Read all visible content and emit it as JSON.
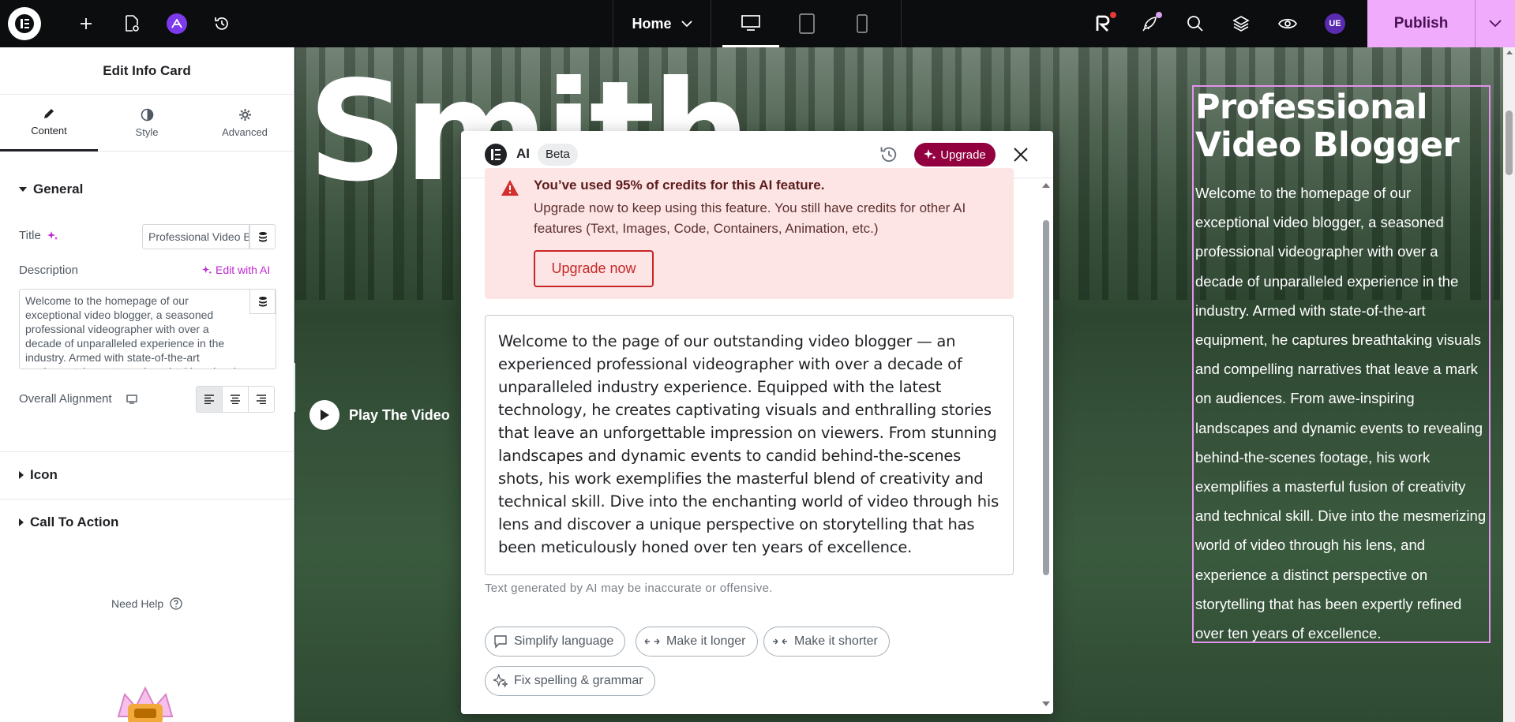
{
  "topbar": {
    "page_selector": "Home",
    "user_initials": "UE",
    "publish_label": "Publish"
  },
  "panel": {
    "title": "Edit Info Card",
    "tabs": [
      {
        "label": "Content",
        "icon": "pencil-icon",
        "active": true
      },
      {
        "label": "Style",
        "icon": "half-circle-icon",
        "active": false
      },
      {
        "label": "Advanced",
        "icon": "gear-icon",
        "active": false
      }
    ],
    "general": {
      "heading": "General",
      "title_label": "Title",
      "title_value": "Professional Video Blogger",
      "description_label": "Description",
      "edit_with_ai": "Edit with AI",
      "description_value": "Welcome to the homepage of our exceptional video blogger, a seasoned professional videographer with over a decade of unparalleled experience in the industry. Armed with state-of-the-art equipment, he captures breathtaking visuals",
      "alignment_label": "Overall Alignment"
    },
    "sections": [
      "Icon",
      "Call To Action"
    ],
    "need_help": "Need Help"
  },
  "canvas": {
    "hero_word": "Smith",
    "play_label": "Play The Video",
    "card_title": "Professional Video Blogger",
    "card_description": "Welcome to the homepage of our exceptional video blogger, a seasoned professional videographer with over a decade of unparalleled experience in the industry. Armed with state-of-the-art equipment, he captures breathtaking visuals and compelling narratives that leave a mark on audiences. From awe-inspiring landscapes and dynamic events to revealing behind-the-scenes footage, his work exemplifies a masterful fusion of creativity and technical skill. Dive into the mesmerizing world of video through his lens, and experience a distinct perspective on storytelling that has been expertly refined over ten years of excellence."
  },
  "ai_modal": {
    "title": "AI",
    "beta": "Beta",
    "upgrade_label": "Upgrade",
    "alert_title": "You’ve used 95% of credits for this AI feature.",
    "alert_text": "Upgrade now to keep using this feature. You still have credits for other AI features (Text, Images, Code, Containers, Animation, etc.)",
    "alert_button": "Upgrade now",
    "result_text": "Welcome to the page of our outstanding video blogger — an experienced professional videographer with over a decade of unparalleled industry experience. Equipped with the latest technology, he creates captivating visuals and enthralling stories that leave an unforgettable impression on viewers. From stunning landscapes and dynamic events to candid behind-the-scenes shots, his work exemplifies the masterful blend of creativity and technical skill. Dive into the enchanting world of video through his lens and discover a unique perspective on storytelling that has been meticulously honed over ten years of excellence.",
    "disclaimer": "Text generated by AI may be inaccurate or offensive.",
    "actions": [
      {
        "label": "Simplify language",
        "icon": "speech-bubble-icon"
      },
      {
        "label": "Make it longer",
        "icon": "expand-arrows-icon"
      },
      {
        "label": "Make it shorter",
        "icon": "shrink-arrows-icon"
      },
      {
        "label": "Fix spelling & grammar",
        "icon": "sparkle-icon"
      }
    ]
  },
  "colors": {
    "publish_bg": "#f0abfc",
    "upgrade_bg": "#93003f",
    "alert_bg": "#fde5e5",
    "ai_accent": "#c026d3"
  }
}
